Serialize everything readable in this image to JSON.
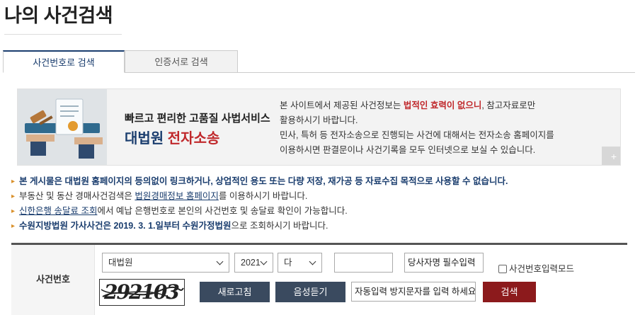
{
  "page": {
    "title": "나의 사건검색"
  },
  "tabs": [
    {
      "label": "사건번호로 검색",
      "active": true
    },
    {
      "label": "인증서로 검색",
      "active": false
    }
  ],
  "banner": {
    "tagline": "빠르고 편리한 고품질 사법서비스",
    "brand_a": "대법원",
    "brand_b": "전자소송",
    "notice_p1": "본 사이트에서 제공된 사건정보는 ",
    "notice_highlight": "법적인 효력이 없으니",
    "notice_p2": ", 참고자료로만",
    "notice_p3": "활용하시기 바랍니다.",
    "notice_p4": "민사, 특허 등 전자소송으로 진행되는 사건에 대해서는 전자소송 홈페이지를",
    "notice_p5": "이용하시면 판결문이나 사건기록을 모두 인터넷으로 보실 수 있습니다.",
    "more_label": "+"
  },
  "notices": {
    "line1": "본 게시물은 대법원 홈페이지의 등의없이 링크하거나, 상업적인 용도 또는 다량 저장, 재가공 등 자료수집 목적으로 사용할 수 없습니다.",
    "line2_a": "부동산 및 동산 경매사건검색은 ",
    "line2_link": "법원경매정보 홈페이지",
    "line2_b": "를 이용하시기 바랍니다.",
    "line3_link": "신한은행 송달료 조회",
    "line3_b": "에서 예납 은행번호로 본인의 사건번호 및 송달료 확인이 가능합니다.",
    "line4_a": "수원지방법원 가사사건은 2019. 3. 1.일부터 수원가정법원",
    "line4_b": "으로 조회하시기 바랍니다."
  },
  "search": {
    "label": "사건번호",
    "court_select": "대법원",
    "year_select": "2021",
    "type_select": "다",
    "case_number_value": "",
    "party_name_placeholder": "당사자명 필수입력",
    "case_mode_label": "사건번호입력모드",
    "case_mode_checked": false,
    "captcha_text": "292103",
    "refresh_label": "새로고침",
    "audio_label": "음성듣기",
    "captcha_input_placeholder": "자동입력 방지문자를 입력 하세요",
    "search_label": "검색"
  }
}
